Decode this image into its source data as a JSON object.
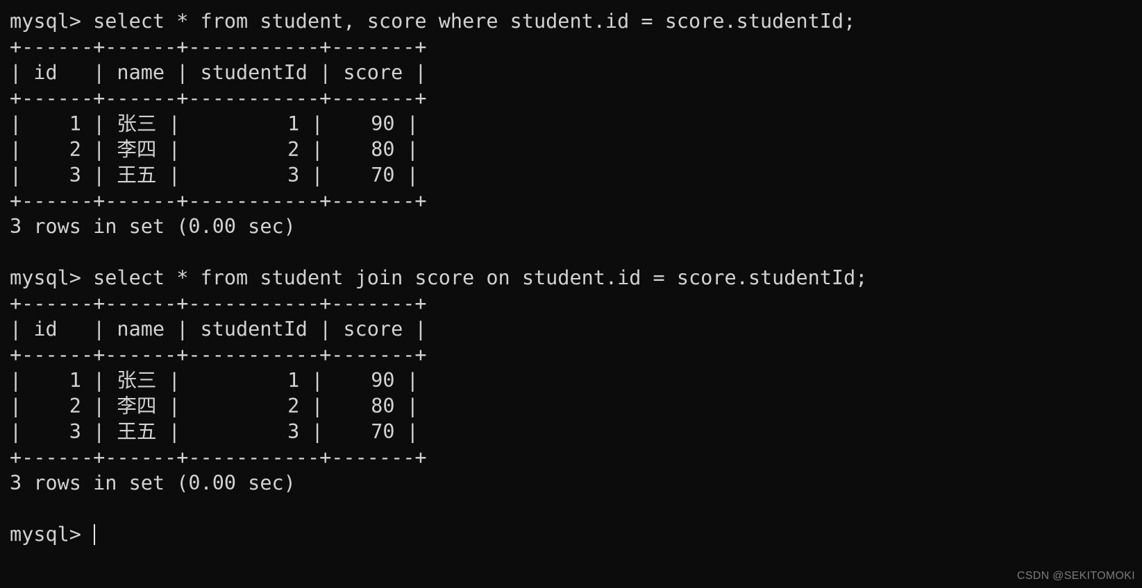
{
  "terminal": {
    "title": "mysql-client-terminal",
    "background_color": "#0c0c0c",
    "foreground_color": "#d2d2d2",
    "watermark": "CSDN @SEKITOMOKI",
    "prompt": "mysql> ",
    "lines": [
      "mysql> select * from student, score where student.id = score.studentId;",
      "+------+------+-----------+-------+",
      "| id   | name | studentId | score |",
      "+------+------+-----------+-------+",
      "|    1 | 张三 |         1 |    90 |",
      "|    2 | 李四 |         2 |    80 |",
      "|    3 | 王五 |         3 |    70 |",
      "+------+------+-----------+-------+",
      "3 rows in set (0.00 sec)",
      "",
      "mysql> select * from student join score on student.id = score.studentId;",
      "+------+------+-----------+-------+",
      "| id   | name | studentId | score |",
      "+------+------+-----------+-------+",
      "|    1 | 张三 |         1 |    90 |",
      "|    2 | 李四 |         2 |    80 |",
      "|    3 | 王五 |         3 |    70 |",
      "+------+------+-----------+-------+",
      "3 rows in set (0.00 sec)",
      ""
    ],
    "queries": [
      {
        "sql": "select * from student, score where student.id = score.studentId;",
        "status": "3 rows in set (0.00 sec)",
        "result": {
          "columns": [
            "id",
            "name",
            "studentId",
            "score"
          ],
          "rows": [
            [
              "1",
              "张三",
              "1",
              "90"
            ],
            [
              "2",
              "李四",
              "2",
              "80"
            ],
            [
              "3",
              "王五",
              "3",
              "70"
            ]
          ]
        }
      },
      {
        "sql": "select * from student join score on student.id = score.studentId;",
        "status": "3 rows in set (0.00 sec)",
        "result": {
          "columns": [
            "id",
            "name",
            "studentId",
            "score"
          ],
          "rows": [
            [
              "1",
              "张三",
              "1",
              "90"
            ],
            [
              "2",
              "李四",
              "2",
              "80"
            ],
            [
              "3",
              "王五",
              "3",
              "70"
            ]
          ]
        }
      }
    ]
  }
}
